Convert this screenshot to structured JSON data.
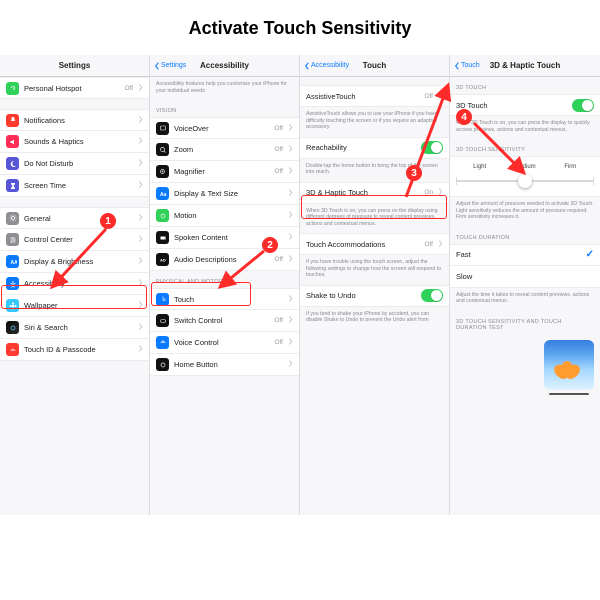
{
  "title": "Activate Touch Sensitivity",
  "callouts": [
    "1",
    "2",
    "3",
    "4"
  ],
  "pane1": {
    "title": "Settings",
    "rows": [
      {
        "icon": "chain",
        "bg": "#30d158",
        "label": "Personal Hotspot",
        "value": "Off"
      },
      {
        "icon": "bell",
        "bg": "#ff3b30",
        "label": "Notifications",
        "value": ""
      },
      {
        "icon": "speaker",
        "bg": "#ff2d55",
        "label": "Sounds & Haptics",
        "value": ""
      },
      {
        "icon": "moon",
        "bg": "#5856d6",
        "label": "Do Not Disturb",
        "value": ""
      },
      {
        "icon": "hourglass",
        "bg": "#5856d6",
        "label": "Screen Time",
        "value": ""
      },
      {
        "icon": "gear",
        "bg": "#8e8e93",
        "label": "General",
        "value": ""
      },
      {
        "icon": "sliders",
        "bg": "#8e8e93",
        "label": "Control Center",
        "value": ""
      },
      {
        "icon": "brightness",
        "bg": "#0a7aff",
        "label": "Display & Brightness",
        "value": ""
      },
      {
        "icon": "accessibility",
        "bg": "#0a7aff",
        "label": "Accessibility",
        "value": ""
      },
      {
        "icon": "flower",
        "bg": "#34c8ff",
        "label": "Wallpaper",
        "value": ""
      },
      {
        "icon": "siri",
        "bg": "#111",
        "label": "Siri & Search",
        "value": ""
      },
      {
        "icon": "fingerprint",
        "bg": "#ff3b30",
        "label": "Touch ID & Passcode",
        "value": ""
      }
    ]
  },
  "pane2": {
    "back": "Settings",
    "title": "Accessibility",
    "intro": "Accessibility features help you customize your iPhone for your individual needs.",
    "group1_label": "VISION",
    "group1": [
      {
        "icon": "vo",
        "bg": "#111",
        "label": "VoiceOver",
        "value": "Off"
      },
      {
        "icon": "zoom",
        "bg": "#111",
        "label": "Zoom",
        "value": "Off"
      },
      {
        "icon": "mag",
        "bg": "#111",
        "label": "Magnifier",
        "value": "Off"
      },
      {
        "icon": "text",
        "bg": "#0a7aff",
        "label": "Display & Text Size",
        "value": ""
      },
      {
        "icon": "motion",
        "bg": "#30d158",
        "label": "Motion",
        "value": ""
      },
      {
        "icon": "spoken",
        "bg": "#111",
        "label": "Spoken Content",
        "value": ""
      },
      {
        "icon": "audiodesc",
        "bg": "#111",
        "label": "Audio Descriptions",
        "value": "Off"
      }
    ],
    "group2_label": "PHYSICAL AND MOTOR",
    "group2": [
      {
        "icon": "touch",
        "bg": "#0a7aff",
        "label": "Touch",
        "value": ""
      },
      {
        "icon": "switch",
        "bg": "#111",
        "label": "Switch Control",
        "value": "Off"
      },
      {
        "icon": "voicectrl",
        "bg": "#0a7aff",
        "label": "Voice Control",
        "value": "Off"
      },
      {
        "icon": "home",
        "bg": "#111",
        "label": "Home Button",
        "value": ""
      }
    ]
  },
  "pane3": {
    "back": "Accessibility",
    "title": "Touch",
    "rows": {
      "at_label": "AssistiveTouch",
      "at_val": "Off",
      "at_desc": "AssistiveTouch allows you to use your iPhone if you have difficulty touching the screen or if you require an adaptive accessory.",
      "reach_label": "Reachability",
      "reach_desc": "Double-tap the home button to bring the top of the screen into reach.",
      "haptic_label": "3D & Haptic Touch",
      "haptic_val": "On",
      "haptic_desc": "When 3D Touch is on, you can press on the display using different degrees of pressure to reveal content previews, actions and contextual menus.",
      "accom_label": "Touch Accommodations",
      "accom_val": "Off",
      "accom_desc": "If you have trouble using the touch screen, adjust the following settings to change how the screen will respond to touches.",
      "shake_label": "Shake to Undo",
      "shake_desc": "If you tend to shake your iPhone by accident, you can disable Shake to Undo to prevent the Undo alert from"
    }
  },
  "pane4": {
    "back": "Touch",
    "title": "3D & Haptic Touch",
    "g1_label": "3D TOUCH",
    "t3d_label": "3D Touch",
    "t3d_desc": "When 3D Touch is on, you can press the display to quickly access previews, actions and contextual menus.",
    "g2_label": "3D TOUCH SENSITIVITY",
    "seg": [
      "Light",
      "Medium",
      "Firm"
    ],
    "sens_desc": "Adjust the amount of pressure needed to activate 3D Touch. Light sensitivity reduces the amount of pressure required. Firm sensitivity increases it.",
    "g3_label": "TOUCH DURATION",
    "fast": "Fast",
    "slow": "Slow",
    "dur_desc": "Adjust the time it takes to reveal content previews, actions and contextual menus.",
    "g4_label": "3D TOUCH SENSITIVITY AND TOUCH DURATION TEST"
  }
}
